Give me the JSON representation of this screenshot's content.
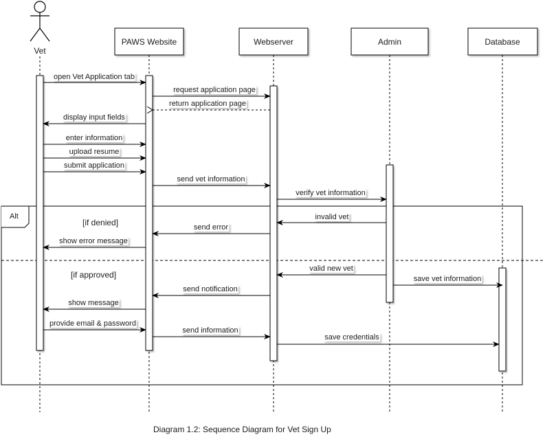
{
  "diagram": {
    "type": "sequence",
    "caption": "Diagram 1.2: Sequence Diagram for Vet Sign Up",
    "actor": {
      "id": "vet",
      "label": "Vet"
    },
    "participants": [
      {
        "id": "paws",
        "label": "PAWS Website"
      },
      {
        "id": "web",
        "label": "Webserver"
      },
      {
        "id": "admin",
        "label": "Admin"
      },
      {
        "id": "db",
        "label": "Database"
      }
    ],
    "fragment": {
      "kind": "Alt",
      "guards": [
        "[if denied]",
        "[if approved]"
      ]
    },
    "messages": [
      {
        "from": "vet",
        "to": "paws",
        "label": "open Vet Application tab",
        "style": "sync"
      },
      {
        "from": "paws",
        "to": "web",
        "label": "request application page",
        "style": "sync"
      },
      {
        "from": "web",
        "to": "paws",
        "label": "return application page",
        "style": "return"
      },
      {
        "from": "paws",
        "to": "vet",
        "label": "display input fields",
        "style": "sync"
      },
      {
        "from": "vet",
        "to": "paws",
        "label": "enter information",
        "style": "sync"
      },
      {
        "from": "vet",
        "to": "paws",
        "label": "upload resume",
        "style": "sync"
      },
      {
        "from": "vet",
        "to": "paws",
        "label": "submit application",
        "style": "sync"
      },
      {
        "from": "paws",
        "to": "web",
        "label": "send vet information",
        "style": "sync"
      },
      {
        "from": "web",
        "to": "admin",
        "label": "verify vet information",
        "style": "sync"
      },
      {
        "from": "admin",
        "to": "web",
        "label": "invalid vet",
        "style": "sync"
      },
      {
        "from": "web",
        "to": "paws",
        "label": "send error",
        "style": "sync"
      },
      {
        "from": "paws",
        "to": "vet",
        "label": "show error message",
        "style": "sync"
      },
      {
        "from": "admin",
        "to": "web",
        "label": "valid new vet",
        "style": "sync"
      },
      {
        "from": "admin",
        "to": "db",
        "label": "save vet information",
        "style": "sync"
      },
      {
        "from": "web",
        "to": "paws",
        "label": "send notification",
        "style": "sync"
      },
      {
        "from": "paws",
        "to": "vet",
        "label": "show message",
        "style": "sync"
      },
      {
        "from": "vet",
        "to": "paws",
        "label": "provide email & password",
        "style": "sync"
      },
      {
        "from": "paws",
        "to": "web",
        "label": "send information",
        "style": "sync"
      },
      {
        "from": "web",
        "to": "db",
        "label": "save credentials",
        "style": "sync"
      }
    ]
  }
}
